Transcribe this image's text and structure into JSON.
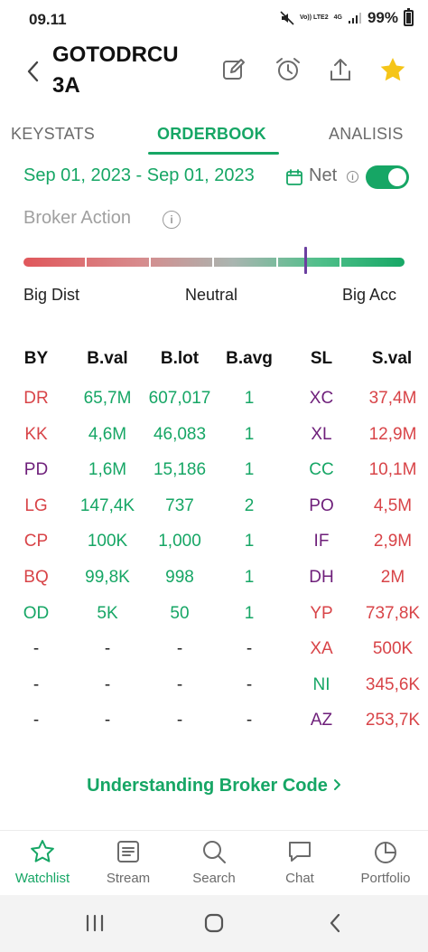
{
  "status_bar": {
    "time": "09.11",
    "network_top": "Vo)) LTE2",
    "network_4g": "4G",
    "battery": "99%"
  },
  "header": {
    "title_line1": "GOTODRCU",
    "title_line2": "3A",
    "icons": [
      "back-icon",
      "edit-icon",
      "alarm-icon",
      "share-icon",
      "star-icon"
    ],
    "star_color": "#f5c518"
  },
  "tabs": [
    {
      "label": "KEYSTATS",
      "active": false
    },
    {
      "label": "ORDERBOOK",
      "active": true
    },
    {
      "label": "ANALISIS",
      "active": false
    }
  ],
  "filter": {
    "date_range": "Sep 01, 2023 - Sep 01, 2023",
    "net_label": "Net",
    "net_enabled": true
  },
  "broker_action": {
    "title": "Broker Action",
    "labels": [
      "Big Dist",
      "Neutral",
      "Big Acc"
    ],
    "marker_position": 0.74
  },
  "colors": {
    "accent_green": "#16a665",
    "red": "#d84448",
    "purple": "#6e1f7a"
  },
  "table": {
    "headers": [
      "BY",
      "B.val",
      "B.lot",
      "B.avg",
      "SL",
      "S.val"
    ],
    "buy_rows": [
      {
        "broker": "DR",
        "broker_color": "red",
        "val": "65,7M",
        "lot": "607,017",
        "avg": "1"
      },
      {
        "broker": "KK",
        "broker_color": "red",
        "val": "4,6M",
        "lot": "46,083",
        "avg": "1"
      },
      {
        "broker": "PD",
        "broker_color": "purple",
        "val": "1,6M",
        "lot": "15,186",
        "avg": "1"
      },
      {
        "broker": "LG",
        "broker_color": "red",
        "val": "147,4K",
        "lot": "737",
        "avg": "2"
      },
      {
        "broker": "CP",
        "broker_color": "red",
        "val": "100K",
        "lot": "1,000",
        "avg": "1"
      },
      {
        "broker": "BQ",
        "broker_color": "red",
        "val": "99,8K",
        "lot": "998",
        "avg": "1"
      },
      {
        "broker": "OD",
        "broker_color": "green",
        "val": "5K",
        "lot": "50",
        "avg": "1"
      },
      {
        "broker": "-",
        "broker_color": "dark",
        "val": "-",
        "lot": "-",
        "avg": "-"
      },
      {
        "broker": "-",
        "broker_color": "dark",
        "val": "-",
        "lot": "-",
        "avg": "-"
      },
      {
        "broker": "-",
        "broker_color": "dark",
        "val": "-",
        "lot": "-",
        "avg": "-"
      }
    ],
    "sell_rows": [
      {
        "broker": "XC",
        "broker_color": "purple",
        "val": "37,4M"
      },
      {
        "broker": "XL",
        "broker_color": "purple",
        "val": "12,9M"
      },
      {
        "broker": "CC",
        "broker_color": "green",
        "val": "10,1M"
      },
      {
        "broker": "PO",
        "broker_color": "purple",
        "val": "4,5M"
      },
      {
        "broker": "IF",
        "broker_color": "purple",
        "val": "2,9M"
      },
      {
        "broker": "DH",
        "broker_color": "purple",
        "val": "2M"
      },
      {
        "broker": "YP",
        "broker_color": "red",
        "val": "737,8K"
      },
      {
        "broker": "XA",
        "broker_color": "red",
        "val": "500K"
      },
      {
        "broker": "NI",
        "broker_color": "green",
        "val": "345,6K"
      },
      {
        "broker": "AZ",
        "broker_color": "purple",
        "val": "253,7K"
      }
    ]
  },
  "link": {
    "label": "Understanding Broker Code"
  },
  "bottom_nav": [
    {
      "label": "Watchlist",
      "icon": "star-outline-icon",
      "active": true
    },
    {
      "label": "Stream",
      "icon": "stream-icon",
      "active": false
    },
    {
      "label": "Search",
      "icon": "search-icon",
      "active": false
    },
    {
      "label": "Chat",
      "icon": "chat-icon",
      "active": false
    },
    {
      "label": "Portfolio",
      "icon": "portfolio-icon",
      "active": false
    }
  ]
}
